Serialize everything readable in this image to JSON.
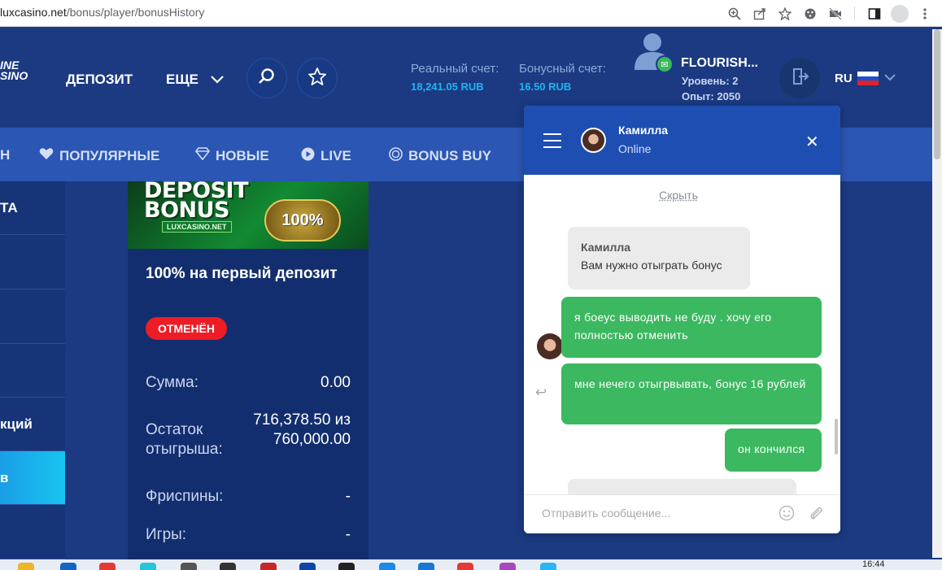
{
  "browser": {
    "url_host": "luxcasino.net",
    "url_path": "/bonus/player/bonusHistory"
  },
  "header": {
    "logo_line1": "INE",
    "logo_line2": "SINO",
    "deposit_label": "ДЕПОЗИТ",
    "more_label": "ЕЩЕ",
    "real_account_label": "Реальный счет:",
    "real_account_amount": "18,241.05 RUB",
    "bonus_account_label": "Бонусный счет:",
    "bonus_account_amount": "16.50 RUB",
    "username": "FLOURISH...",
    "level": "Уровень: 2",
    "experience": "Опыт: 2050",
    "language": "RU"
  },
  "categories": [
    {
      "label": "Н",
      "icon": ""
    },
    {
      "label": "ПОПУЛЯРНЫЕ",
      "icon": "heart-icon"
    },
    {
      "label": "НОВЫЕ",
      "icon": "diamond-icon"
    },
    {
      "label": "LIVE",
      "icon": "play-icon"
    },
    {
      "label": "BONUS BUY",
      "icon": "coin-icon"
    }
  ],
  "sidebar": {
    "items": [
      "ТА",
      "",
      "",
      "",
      "кций",
      "в"
    ]
  },
  "bonus_card": {
    "banner_line1": "DEPOSIT",
    "banner_line2": "BONUS",
    "banner_site": "LUXCASINO.NET",
    "banner_slot": "100%",
    "title": "100% на первый депозит",
    "status": "ОТМЕНЁН",
    "rows": [
      {
        "label": "Сумма:",
        "value": "0.00"
      },
      {
        "label": "Остаток отыгрыша:",
        "value": "716,378.50 из 760,000.00"
      },
      {
        "label": "Фриспины:",
        "value": "-"
      },
      {
        "label": "Игры:",
        "value": "-"
      }
    ]
  },
  "chat": {
    "agent_name": "Камилла",
    "agent_status": "Online",
    "hide_link": "Скрыть",
    "messages": [
      {
        "from": "agent",
        "sender": "Камилла",
        "text": "Вам нужно отыграть бонус"
      },
      {
        "from": "user",
        "text": "я боеус выводить не буду . хочу его полностью отменить"
      },
      {
        "from": "user",
        "text": "мне нечего отыгрвывать, бонус 16 рублей"
      },
      {
        "from": "user",
        "text": "он кончился"
      }
    ],
    "input_placeholder": "Отправить сообщение..."
  },
  "taskbar": {
    "time": "16:44"
  },
  "colors": {
    "site_bg": "#1b3a82",
    "category_bar": "#2b56b3",
    "accent_blue": "#1fb4f0",
    "cancel_red": "#ee1c25",
    "chat_green": "#3cb860",
    "chat_header": "#1e4eb2"
  }
}
